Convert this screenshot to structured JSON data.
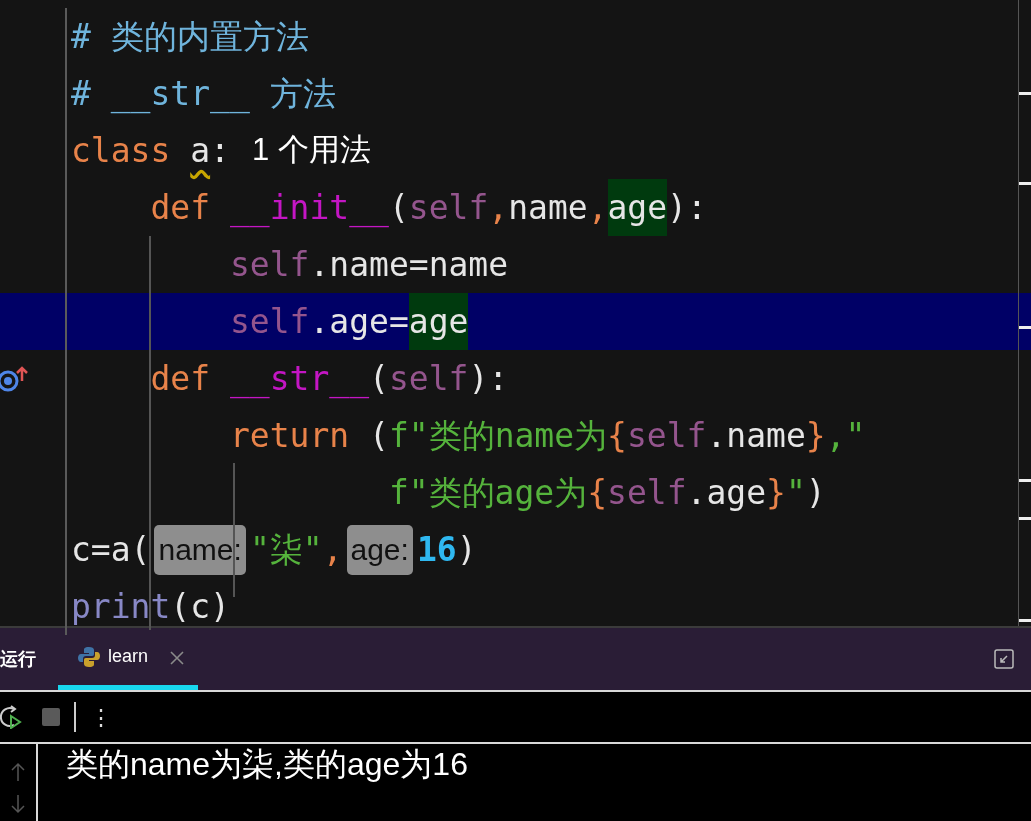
{
  "editor": {
    "lines": [
      {
        "current": false,
        "tokens": [
          {
            "text": "# 类的内置方法",
            "kind": "comment"
          }
        ]
      },
      {
        "current": false,
        "tokens": [
          {
            "text": "# __str__ 方法",
            "kind": "comment"
          }
        ]
      },
      {
        "current": false,
        "tokens": [
          {
            "text": "class ",
            "kind": "keyword"
          },
          {
            "text": "a",
            "kind": "warned"
          },
          {
            "text": ":",
            "kind": "plain"
          },
          {
            "text": "1 个用法",
            "kind": "usage"
          }
        ]
      },
      {
        "current": false,
        "tokens": [
          {
            "text": "    def ",
            "kind": "keyword"
          },
          {
            "text": "__init__",
            "kind": "magic"
          },
          {
            "text": "(",
            "kind": "plain"
          },
          {
            "text": "self",
            "kind": "self"
          },
          {
            "text": ",",
            "kind": "punct"
          },
          {
            "text": "name",
            "kind": "plain"
          },
          {
            "text": ",",
            "kind": "punct"
          },
          {
            "text": "age",
            "kind": "match"
          },
          {
            "text": "):",
            "kind": "plain"
          }
        ]
      },
      {
        "current": false,
        "tokens": [
          {
            "text": "        self",
            "kind": "self"
          },
          {
            "text": ".name=name",
            "kind": "plain"
          }
        ]
      },
      {
        "current": true,
        "tokens": [
          {
            "text": "        self",
            "kind": "self"
          },
          {
            "text": ".age=",
            "kind": "plain"
          },
          {
            "text": "age",
            "kind": "match"
          }
        ]
      },
      {
        "current": false,
        "override": true,
        "tokens": [
          {
            "text": "    def ",
            "kind": "keyword"
          },
          {
            "text": "__str__",
            "kind": "magic"
          },
          {
            "text": "(",
            "kind": "plain"
          },
          {
            "text": "self",
            "kind": "self"
          },
          {
            "text": "):",
            "kind": "plain"
          }
        ]
      },
      {
        "current": false,
        "tokens": [
          {
            "text": "        return ",
            "kind": "keyword"
          },
          {
            "text": "(",
            "kind": "plain"
          },
          {
            "text": "f\"类的name为",
            "kind": "string"
          },
          {
            "text": "{",
            "kind": "brace"
          },
          {
            "text": "self",
            "kind": "self"
          },
          {
            "text": ".name",
            "kind": "plain"
          },
          {
            "text": "}",
            "kind": "brace"
          },
          {
            "text": ",\"",
            "kind": "string"
          }
        ]
      },
      {
        "current": false,
        "tokens": [
          {
            "text": "                f\"类的age为",
            "kind": "string"
          },
          {
            "text": "{",
            "kind": "brace"
          },
          {
            "text": "self",
            "kind": "self"
          },
          {
            "text": ".age",
            "kind": "plain"
          },
          {
            "text": "}",
            "kind": "brace"
          },
          {
            "text": "\"",
            "kind": "string"
          },
          {
            "text": ")",
            "kind": "plain"
          }
        ]
      },
      {
        "current": false,
        "tokens": [
          {
            "text": "c=a(",
            "kind": "plain"
          },
          {
            "text": "name:",
            "kind": "hint"
          },
          {
            "text": "\"柒\"",
            "kind": "string"
          },
          {
            "text": ",",
            "kind": "punct"
          },
          {
            "text": "age:",
            "kind": "hint"
          },
          {
            "text": "16",
            "kind": "number"
          },
          {
            "text": ")",
            "kind": "plain"
          }
        ]
      },
      {
        "current": false,
        "tokens": [
          {
            "text": "print",
            "kind": "builtin"
          },
          {
            "text": "(c)",
            "kind": "plain"
          }
        ]
      }
    ]
  },
  "run_panel": {
    "title": "运行",
    "tabs": [
      {
        "label": "learn",
        "selected": true,
        "closable": true
      }
    ],
    "toolbar": {
      "more": "⋮"
    },
    "output": "类的name为柒,类的age为16"
  }
}
